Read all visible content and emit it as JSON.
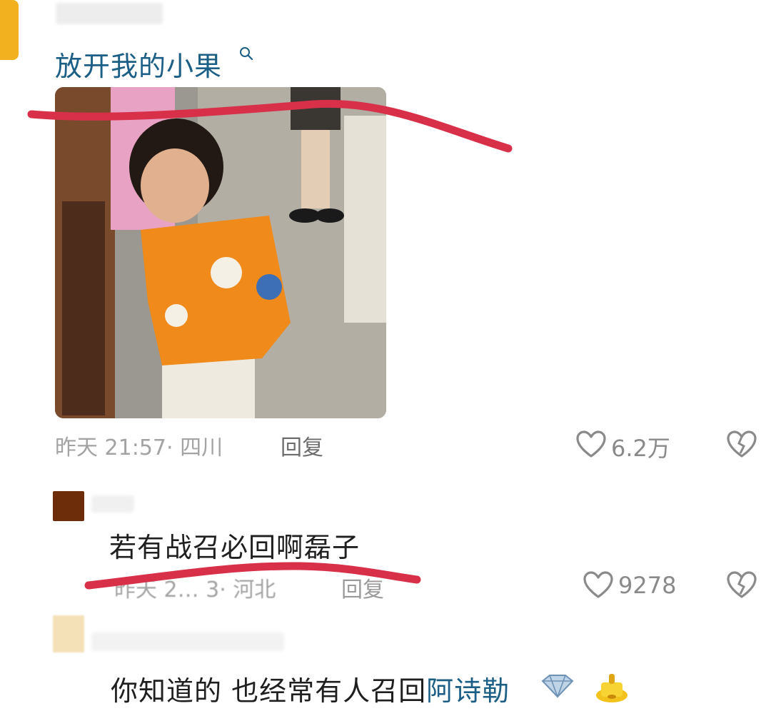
{
  "comments": [
    {
      "text": "放开我的小果",
      "meta": "昨天 21:57· 四川",
      "reply": "回复",
      "likes": "6.2万",
      "link_color": "#1c5f86"
    },
    {
      "text": "若有战召必回啊磊子",
      "meta": "昨天 2… 3· 河北",
      "reply": "回复",
      "likes": "9278"
    },
    {
      "text_prefix": "你知道的 也经常有人召回",
      "text_link": "阿诗勒",
      "link_color": "#1c5f86"
    }
  ],
  "icons": [
    "search-icon",
    "heart-outline-icon",
    "broken-heart-icon",
    "diamond-emoji-icon",
    "trophy-emoji-icon"
  ],
  "annotation_color": "#d9304a"
}
